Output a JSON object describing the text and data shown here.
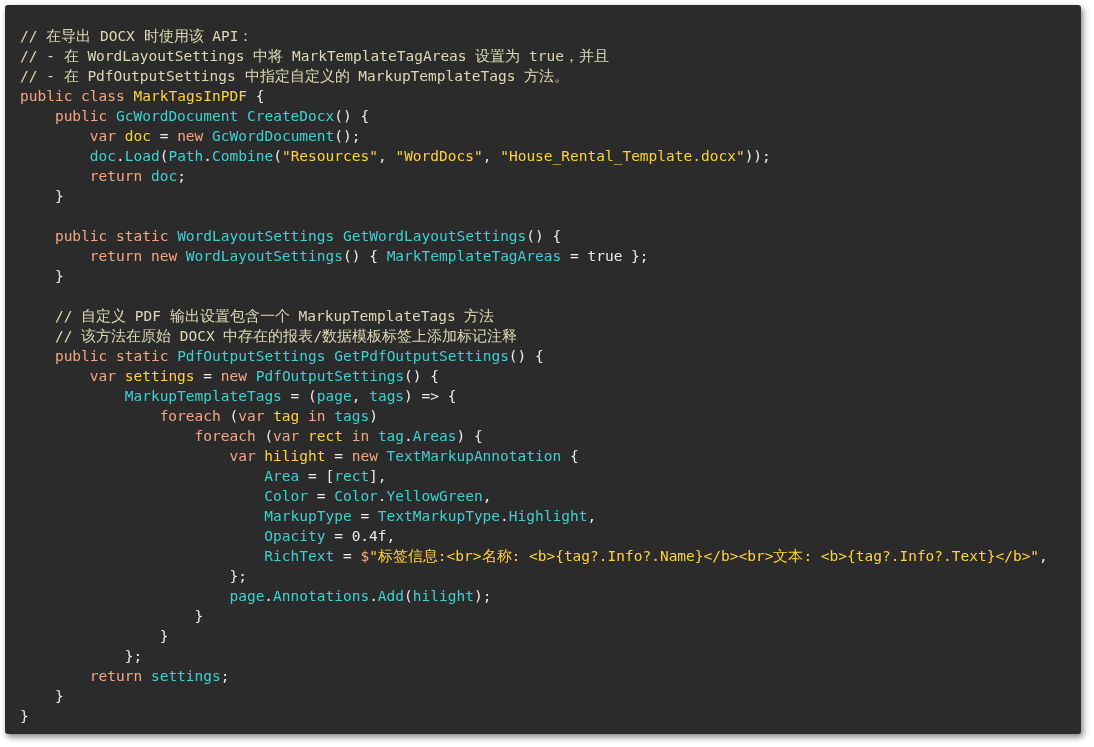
{
  "code": {
    "lines": [
      {
        "kind": "code",
        "tokens": [
          {
            "kind": "comment",
            "text": "// 在导出 DOCX 时使用该 API："
          }
        ]
      },
      {
        "kind": "code",
        "tokens": [
          {
            "kind": "comment",
            "text": "// - 在 WordLayoutSettings 中将 MarkTemplateTagAreas 设置为 true，并且"
          }
        ]
      },
      {
        "kind": "code",
        "tokens": [
          {
            "kind": "comment",
            "text": "// - 在 PdfOutputSettings 中指定自定义的 MarkupTemplateTags 方法。"
          }
        ]
      },
      {
        "kind": "code",
        "tokens": [
          {
            "kind": "keyword",
            "text": "public class "
          },
          {
            "kind": "name",
            "text": "MarkTagsInPDF"
          },
          {
            "kind": "plain",
            "text": " {"
          }
        ]
      },
      {
        "kind": "block",
        "children": [
          {
            "kind": "code",
            "tokens": [
              {
                "kind": "keyword",
                "text": "public "
              },
              {
                "kind": "type",
                "text": "GcWordDocument CreateDocx"
              },
              {
                "kind": "plain",
                "text": "() {"
              }
            ]
          },
          {
            "kind": "block",
            "children": [
              {
                "kind": "code",
                "tokens": [
                  {
                    "kind": "keyword",
                    "text": "var "
                  },
                  {
                    "kind": "name",
                    "text": "doc"
                  },
                  {
                    "kind": "plain",
                    "text": " = "
                  },
                  {
                    "kind": "keyword",
                    "text": "new "
                  },
                  {
                    "kind": "type",
                    "text": "GcWordDocument"
                  },
                  {
                    "kind": "plain",
                    "text": "();"
                  }
                ]
              },
              {
                "kind": "code",
                "tokens": [
                  {
                    "kind": "type",
                    "text": "doc"
                  },
                  {
                    "kind": "plain",
                    "text": "."
                  },
                  {
                    "kind": "type",
                    "text": "Load"
                  },
                  {
                    "kind": "plain",
                    "text": "("
                  },
                  {
                    "kind": "type",
                    "text": "Path"
                  },
                  {
                    "kind": "plain",
                    "text": "."
                  },
                  {
                    "kind": "type",
                    "text": "Combine"
                  },
                  {
                    "kind": "plain",
                    "text": "("
                  },
                  {
                    "kind": "string",
                    "text": "\"Resources\""
                  },
                  {
                    "kind": "plain",
                    "text": ", "
                  },
                  {
                    "kind": "string",
                    "text": "\"WordDocs\""
                  },
                  {
                    "kind": "plain",
                    "text": ", "
                  },
                  {
                    "kind": "string",
                    "text": "\"House_Rental_Template.docx\""
                  },
                  {
                    "kind": "plain",
                    "text": "));"
                  }
                ]
              },
              {
                "kind": "code",
                "tokens": [
                  {
                    "kind": "keyword",
                    "text": "return "
                  },
                  {
                    "kind": "type",
                    "text": "doc"
                  },
                  {
                    "kind": "plain",
                    "text": ";"
                  }
                ]
              }
            ]
          },
          {
            "kind": "code",
            "tokens": [
              {
                "kind": "plain",
                "text": "}"
              }
            ]
          },
          {
            "kind": "blank"
          },
          {
            "kind": "code",
            "tokens": [
              {
                "kind": "keyword",
                "text": "public static "
              },
              {
                "kind": "type",
                "text": "WordLayoutSettings GetWordLayoutSettings"
              },
              {
                "kind": "plain",
                "text": "() {"
              }
            ]
          },
          {
            "kind": "block",
            "children": [
              {
                "kind": "code",
                "tokens": [
                  {
                    "kind": "keyword",
                    "text": "return new "
                  },
                  {
                    "kind": "type",
                    "text": "WordLayoutSettings"
                  },
                  {
                    "kind": "plain",
                    "text": "() { "
                  },
                  {
                    "kind": "type",
                    "text": "MarkTemplateTagAreas"
                  },
                  {
                    "kind": "plain",
                    "text": " = true };"
                  }
                ]
              }
            ]
          },
          {
            "kind": "code",
            "tokens": [
              {
                "kind": "plain",
                "text": "}"
              }
            ]
          },
          {
            "kind": "blank"
          },
          {
            "kind": "code",
            "tokens": [
              {
                "kind": "comment",
                "text": "// 自定义 PDF 输出设置包含一个 MarkupTemplateTags 方法"
              }
            ]
          },
          {
            "kind": "code",
            "tokens": [
              {
                "kind": "comment",
                "text": "// 该方法在原始 DOCX 中存在的报表/数据模板标签上添加标记注释"
              }
            ]
          },
          {
            "kind": "code",
            "tokens": [
              {
                "kind": "keyword",
                "text": "public static "
              },
              {
                "kind": "type",
                "text": "PdfOutputSettings GetPdfOutputSettings"
              },
              {
                "kind": "plain",
                "text": "() {"
              }
            ]
          },
          {
            "kind": "block",
            "children": [
              {
                "kind": "code",
                "tokens": [
                  {
                    "kind": "keyword",
                    "text": "var "
                  },
                  {
                    "kind": "name",
                    "text": "settings"
                  },
                  {
                    "kind": "plain",
                    "text": " = "
                  },
                  {
                    "kind": "keyword",
                    "text": "new "
                  },
                  {
                    "kind": "type",
                    "text": "PdfOutputSettings"
                  },
                  {
                    "kind": "plain",
                    "text": "() {"
                  }
                ]
              },
              {
                "kind": "block",
                "children": [
                  {
                    "kind": "code",
                    "tokens": [
                      {
                        "kind": "type",
                        "text": "MarkupTemplateTags"
                      },
                      {
                        "kind": "plain",
                        "text": " = ("
                      },
                      {
                        "kind": "type",
                        "text": "page"
                      },
                      {
                        "kind": "plain",
                        "text": ", "
                      },
                      {
                        "kind": "type",
                        "text": "tags"
                      },
                      {
                        "kind": "plain",
                        "text": ") => {"
                      }
                    ]
                  },
                  {
                    "kind": "block",
                    "children": [
                      {
                        "kind": "code",
                        "tokens": [
                          {
                            "kind": "keyword",
                            "text": "foreach "
                          },
                          {
                            "kind": "plain",
                            "text": "("
                          },
                          {
                            "kind": "keyword",
                            "text": "var "
                          },
                          {
                            "kind": "name",
                            "text": "tag"
                          },
                          {
                            "kind": "keyword",
                            "text": " in "
                          },
                          {
                            "kind": "type",
                            "text": "tags"
                          },
                          {
                            "kind": "plain",
                            "text": ")"
                          }
                        ]
                      },
                      {
                        "kind": "block",
                        "children": [
                          {
                            "kind": "code",
                            "tokens": [
                              {
                                "kind": "keyword",
                                "text": "foreach "
                              },
                              {
                                "kind": "plain",
                                "text": "("
                              },
                              {
                                "kind": "keyword",
                                "text": "var "
                              },
                              {
                                "kind": "name",
                                "text": "rect"
                              },
                              {
                                "kind": "keyword",
                                "text": " in "
                              },
                              {
                                "kind": "type",
                                "text": "tag"
                              },
                              {
                                "kind": "plain",
                                "text": "."
                              },
                              {
                                "kind": "type",
                                "text": "Areas"
                              },
                              {
                                "kind": "plain",
                                "text": ") {"
                              }
                            ]
                          },
                          {
                            "kind": "block",
                            "children": [
                              {
                                "kind": "code",
                                "tokens": [
                                  {
                                    "kind": "keyword",
                                    "text": "var "
                                  },
                                  {
                                    "kind": "name",
                                    "text": "hilight"
                                  },
                                  {
                                    "kind": "plain",
                                    "text": " = "
                                  },
                                  {
                                    "kind": "keyword",
                                    "text": "new "
                                  },
                                  {
                                    "kind": "type",
                                    "text": "TextMarkupAnnotation"
                                  },
                                  {
                                    "kind": "plain",
                                    "text": " {"
                                  }
                                ]
                              },
                              {
                                "kind": "block",
                                "children": [
                                  {
                                    "kind": "code",
                                    "tokens": [
                                      {
                                        "kind": "type",
                                        "text": "Area"
                                      },
                                      {
                                        "kind": "plain",
                                        "text": " = ["
                                      },
                                      {
                                        "kind": "type",
                                        "text": "rect"
                                      },
                                      {
                                        "kind": "plain",
                                        "text": "],"
                                      }
                                    ]
                                  },
                                  {
                                    "kind": "code",
                                    "tokens": [
                                      {
                                        "kind": "type",
                                        "text": "Color"
                                      },
                                      {
                                        "kind": "plain",
                                        "text": " = "
                                      },
                                      {
                                        "kind": "type",
                                        "text": "Color"
                                      },
                                      {
                                        "kind": "plain",
                                        "text": "."
                                      },
                                      {
                                        "kind": "type",
                                        "text": "YellowGreen"
                                      },
                                      {
                                        "kind": "plain",
                                        "text": ","
                                      }
                                    ]
                                  },
                                  {
                                    "kind": "code",
                                    "tokens": [
                                      {
                                        "kind": "type",
                                        "text": "MarkupType"
                                      },
                                      {
                                        "kind": "plain",
                                        "text": " = "
                                      },
                                      {
                                        "kind": "type",
                                        "text": "TextMarkupType"
                                      },
                                      {
                                        "kind": "plain",
                                        "text": "."
                                      },
                                      {
                                        "kind": "type",
                                        "text": "Highlight"
                                      },
                                      {
                                        "kind": "plain",
                                        "text": ","
                                      }
                                    ]
                                  },
                                  {
                                    "kind": "code",
                                    "tokens": [
                                      {
                                        "kind": "type",
                                        "text": "Opacity"
                                      },
                                      {
                                        "kind": "plain",
                                        "text": " = 0.4f,"
                                      }
                                    ]
                                  },
                                  {
                                    "kind": "code",
                                    "tokens": [
                                      {
                                        "kind": "type",
                                        "text": "RichText"
                                      },
                                      {
                                        "kind": "plain",
                                        "text": " = "
                                      },
                                      {
                                        "kind": "keyword",
                                        "text": "$"
                                      },
                                      {
                                        "kind": "string",
                                        "text": "\"标签信息:<br>名称: <b>{tag?.Info?.Name}</b><br>文本: <b>{tag?.Info?.Text}</b>\""
                                      },
                                      {
                                        "kind": "plain",
                                        "text": ","
                                      }
                                    ]
                                  }
                                ]
                              },
                              {
                                "kind": "code",
                                "tokens": [
                                  {
                                    "kind": "plain",
                                    "text": "};"
                                  }
                                ]
                              },
                              {
                                "kind": "code",
                                "tokens": [
                                  {
                                    "kind": "type",
                                    "text": "page"
                                  },
                                  {
                                    "kind": "plain",
                                    "text": "."
                                  },
                                  {
                                    "kind": "type",
                                    "text": "Annotations"
                                  },
                                  {
                                    "kind": "plain",
                                    "text": "."
                                  },
                                  {
                                    "kind": "type",
                                    "text": "Add"
                                  },
                                  {
                                    "kind": "plain",
                                    "text": "("
                                  },
                                  {
                                    "kind": "type",
                                    "text": "hilight"
                                  },
                                  {
                                    "kind": "plain",
                                    "text": ");"
                                  }
                                ]
                              }
                            ]
                          },
                          {
                            "kind": "code",
                            "tokens": [
                              {
                                "kind": "plain",
                                "text": "}"
                              }
                            ]
                          }
                        ]
                      },
                      {
                        "kind": "code",
                        "tokens": [
                          {
                            "kind": "plain",
                            "text": "}"
                          }
                        ]
                      }
                    ]
                  },
                  {
                    "kind": "code",
                    "tokens": [
                      {
                        "kind": "plain",
                        "text": "};"
                      }
                    ]
                  }
                ]
              },
              {
                "kind": "code",
                "tokens": [
                  {
                    "kind": "keyword",
                    "text": "return "
                  },
                  {
                    "kind": "type",
                    "text": "settings"
                  },
                  {
                    "kind": "plain",
                    "text": ";"
                  }
                ]
              }
            ]
          },
          {
            "kind": "code",
            "tokens": [
              {
                "kind": "plain",
                "text": "}"
              }
            ]
          }
        ]
      },
      {
        "kind": "code",
        "tokens": [
          {
            "kind": "plain",
            "text": "}"
          }
        ]
      }
    ]
  }
}
